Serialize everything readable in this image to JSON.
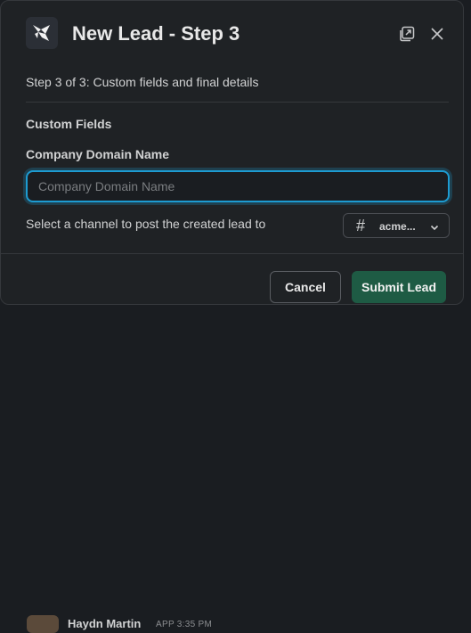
{
  "modal": {
    "title": "New Lead - Step 3",
    "step_text": "Step 3 of 3: Custom fields and final details",
    "section_title": "Custom Fields",
    "field_label": "Company Domain Name",
    "field_placeholder": "Company Domain Name",
    "field_value": "",
    "channel_label": "Select a channel to post the created lead to",
    "channel_selected": "acme...",
    "cancel_label": "Cancel",
    "submit_label": "Submit Lead"
  },
  "background": {
    "message_author": "Haydn Martin",
    "message_meta": "APP  3:35 PM"
  },
  "colors": {
    "focus_ring": "#1d9bd1",
    "submit_bg": "#1e5b44",
    "modal_bg": "#1f2225"
  },
  "icons": {
    "app_icon": "lead-app-icon",
    "popout": "popout-icon",
    "close": "close-icon",
    "channel_hash": "hash-icon",
    "dropdown": "chevron-down-icon"
  }
}
